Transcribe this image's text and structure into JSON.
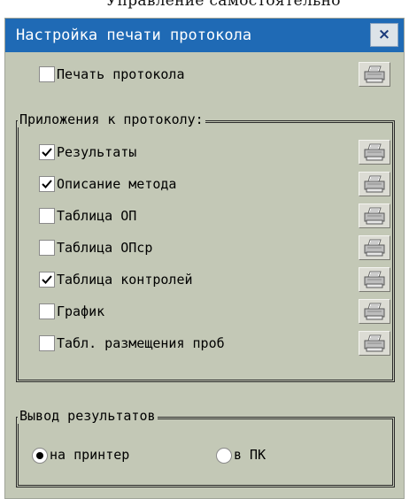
{
  "page_top_text": "Управление самостоятельно",
  "window": {
    "title": "Настройка печати протокола",
    "close_label": "×"
  },
  "print_protocol": {
    "label": "Печать протокола",
    "checked": false
  },
  "attachments": {
    "title": "Приложения к протоколу:",
    "items": [
      {
        "label": "Результаты",
        "checked": true
      },
      {
        "label": "Описание метода",
        "checked": true
      },
      {
        "label": "Таблица ОП",
        "checked": false
      },
      {
        "label": "Таблица ОПср",
        "checked": false
      },
      {
        "label": "Таблица контролей",
        "checked": true
      },
      {
        "label": "График",
        "checked": false
      },
      {
        "label": "Табл. размещения проб",
        "checked": false
      }
    ]
  },
  "output": {
    "title": "Вывод результатов",
    "options": [
      {
        "label": "на принтер",
        "selected": true
      },
      {
        "label": "в ПК",
        "selected": false
      }
    ]
  },
  "colors": {
    "titlebar": "#1f6ab5",
    "dialog_bg": "#c3c8b6",
    "close_button_bg": "#dde3e8"
  },
  "icons": {
    "print": "printer-icon",
    "check": "checkmark-icon",
    "close": "close-icon"
  }
}
